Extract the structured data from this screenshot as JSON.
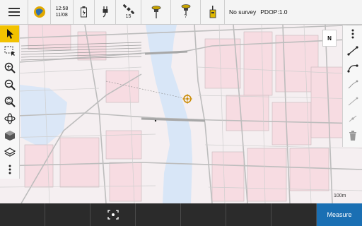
{
  "topbar": {
    "time": "12:58",
    "date": "11/08",
    "satellites": "15",
    "receiver_status": "?",
    "survey_status": "No survey",
    "pdop": "PDOP:1.0"
  },
  "map": {
    "scale_label": "100m",
    "north_label": "N"
  },
  "bottom": {
    "measure_label": "Measure"
  },
  "icons": {
    "menu": "hamburger-icon",
    "globe": "globe-icon",
    "battery": "battery-icon",
    "power": "plug-icon",
    "satellite": "satellite-icon",
    "receiver": "gnss-receiver-icon",
    "receiver2": "gnss-receiver-question-icon",
    "radio": "radio-icon",
    "select": "pointer-icon",
    "box_select": "box-select-icon",
    "zoom_in": "zoom-in-icon",
    "zoom_out": "zoom-out-icon",
    "zoom_extents": "zoom-extents-icon",
    "orbit": "orbit-icon",
    "view3d": "cube-icon",
    "layers": "layers-icon",
    "more": "more-vertical-icon",
    "focus": "focus-icon"
  },
  "colors": {
    "accent": "#f2c200",
    "measure_button": "#1a6fb3",
    "water": "#d8e6f7",
    "building": "#f7dce2",
    "road": "#c9c9c9"
  }
}
